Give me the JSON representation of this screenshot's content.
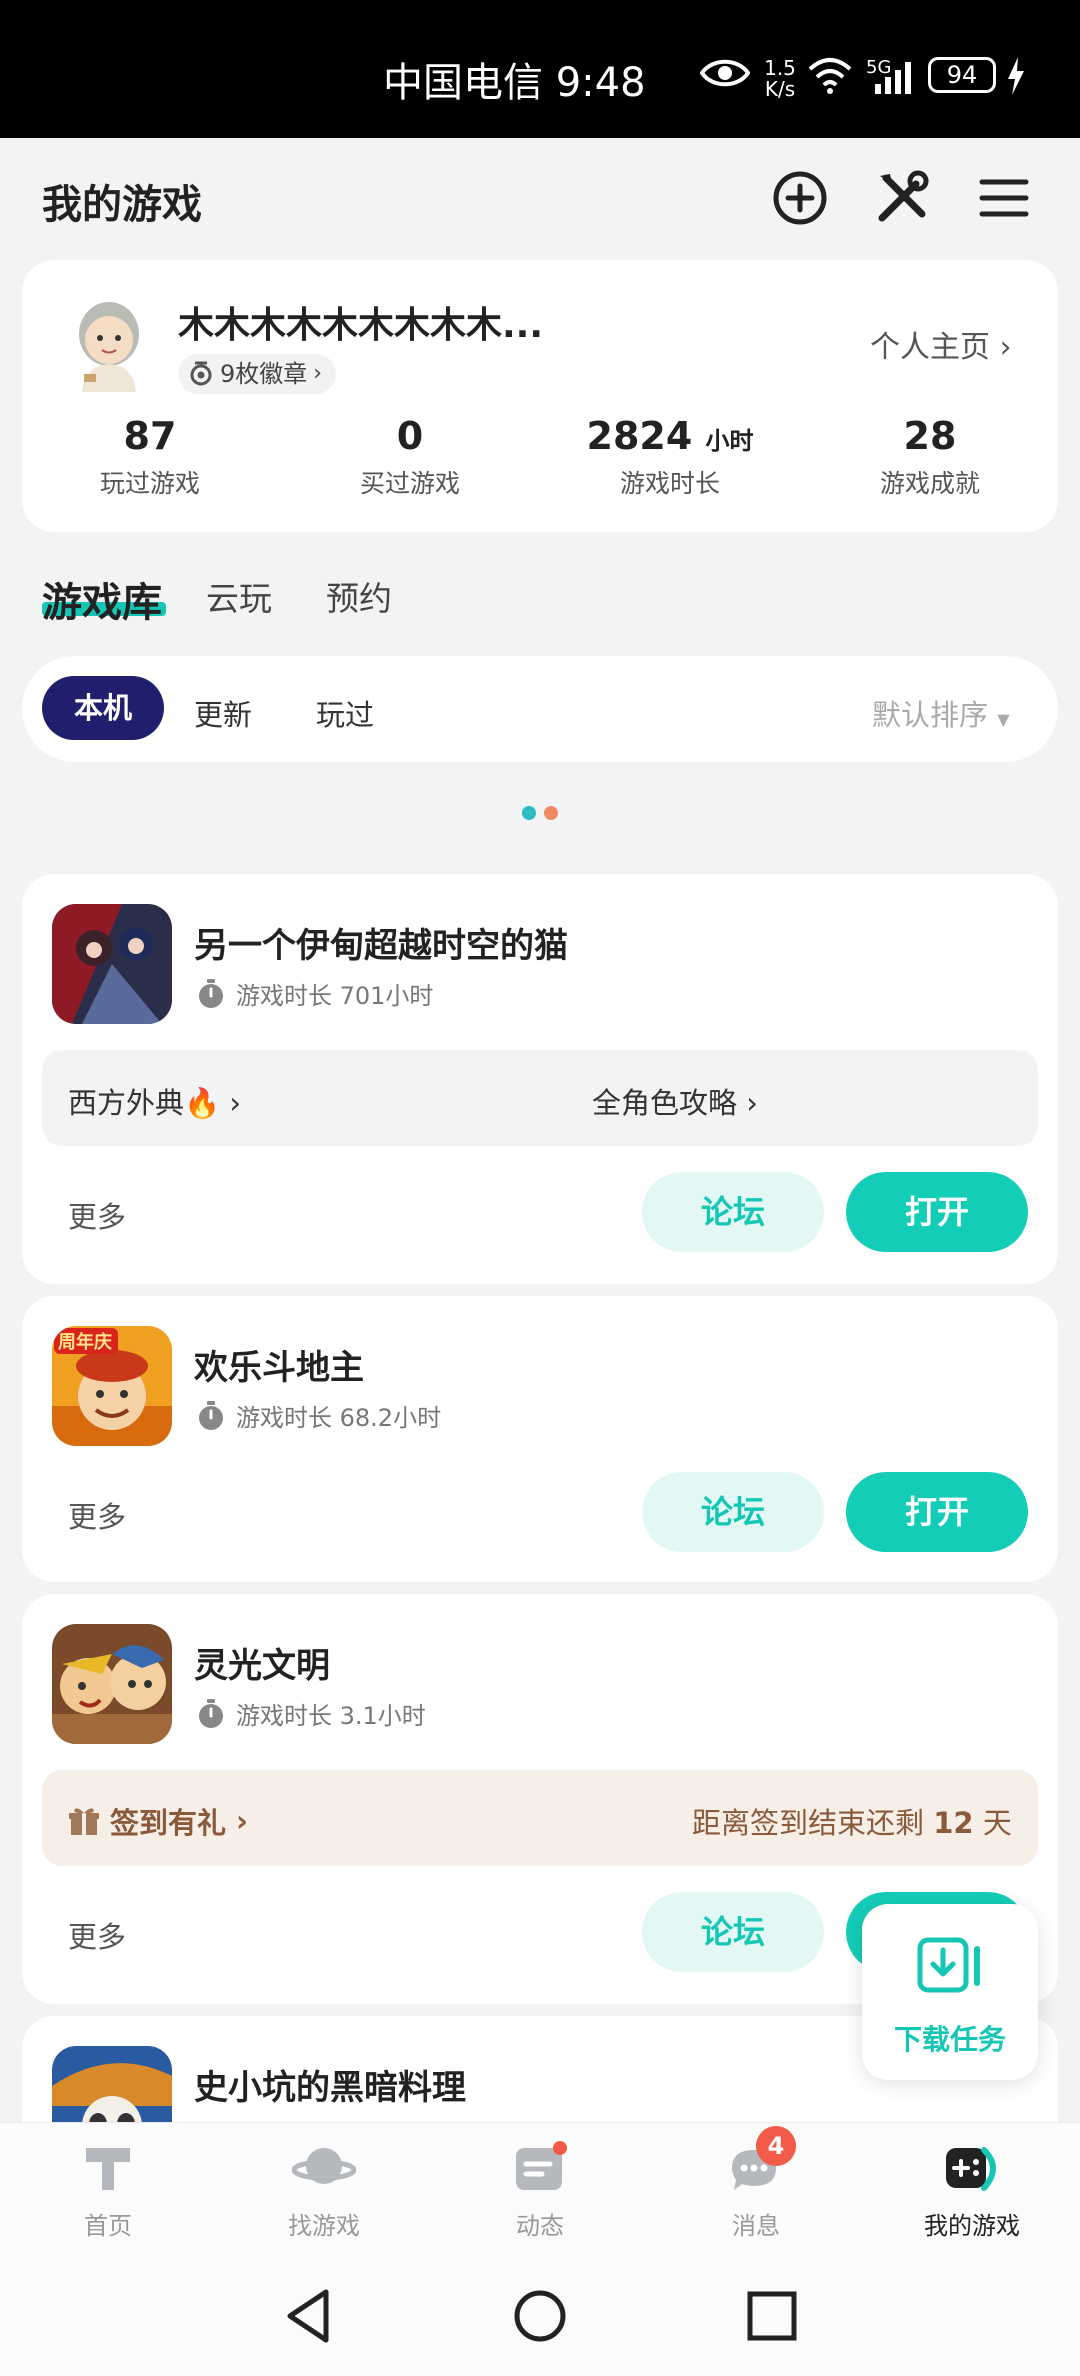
{
  "status_bar": {
    "carrier_time": "中国电信 9:48",
    "speed_value": "1.5",
    "speed_unit": "K/s",
    "network": "5G",
    "battery": "94"
  },
  "header": {
    "title": "我的游戏"
  },
  "profile": {
    "nickname": "木木木木木木木木木...",
    "badges": "9枚徽章",
    "homepage_link": "个人主页",
    "stats": [
      {
        "value": "87",
        "unit": "",
        "label": "玩过游戏"
      },
      {
        "value": "0",
        "unit": "",
        "label": "买过游戏"
      },
      {
        "value": "2824",
        "unit": "小时",
        "label": "游戏时长"
      },
      {
        "value": "28",
        "unit": "",
        "label": "游戏成就"
      }
    ]
  },
  "tabs": {
    "library": "游戏库",
    "cloud": "云玩",
    "reserve": "预约"
  },
  "filters": {
    "local": "本机",
    "updates": "更新",
    "played": "玩过",
    "sort": "默认排序"
  },
  "games": [
    {
      "name": "另一个伊甸超越时空的猫",
      "playtime": "游戏时长 701小时",
      "panel_left": "西方外典",
      "panel_right": "全角色攻略",
      "more": "更多",
      "forum": "论坛",
      "open": "打开"
    },
    {
      "name": "欢乐斗地主",
      "playtime": "游戏时长 68.2小时",
      "icon_badge": "周年庆",
      "more": "更多",
      "forum": "论坛",
      "open": "打开"
    },
    {
      "name": "灵光文明",
      "playtime": "游戏时长 3.1小时",
      "checkin_label": "签到有礼",
      "checkin_prefix": "距离签到结束还剩",
      "checkin_days": "12",
      "checkin_suffix": "天",
      "more": "更多",
      "forum": "论坛",
      "open": "打开"
    },
    {
      "name": "史小坑的黑暗料理"
    }
  ],
  "floating": {
    "download_tasks": "下载任务"
  },
  "bottom_nav": [
    {
      "label": "首页"
    },
    {
      "label": "找游戏"
    },
    {
      "label": "动态"
    },
    {
      "label": "消息",
      "badge": "4"
    },
    {
      "label": "我的游戏"
    }
  ],
  "colors": {
    "accent": "#16c6b4",
    "chip_active": "#1f1f6e",
    "notify": "#f25a4a"
  }
}
